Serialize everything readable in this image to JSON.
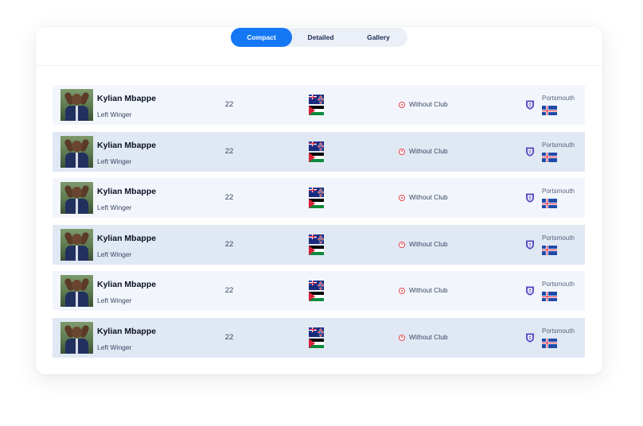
{
  "view_toggle": {
    "tabs": [
      {
        "label": "Compact",
        "active": true
      },
      {
        "label": "Detailed",
        "active": false
      },
      {
        "label": "Gallery",
        "active": false
      }
    ]
  },
  "players": [
    {
      "name": "Kylian Mbappe",
      "position": "Left Winger",
      "age": "22",
      "nationality_flags": [
        "new-zealand-flag",
        "palestine-flag"
      ],
      "club_status": "Without Club",
      "former_club": "Portsmouth",
      "former_club_flag": "iceland-flag"
    },
    {
      "name": "Kylian Mbappe",
      "position": "Left Winger",
      "age": "22",
      "nationality_flags": [
        "new-zealand-flag",
        "palestine-flag"
      ],
      "club_status": "Without Club",
      "former_club": "Portsmouth",
      "former_club_flag": "iceland-flag"
    },
    {
      "name": "Kylian Mbappe",
      "position": "Left Winger",
      "age": "22",
      "nationality_flags": [
        "new-zealand-flag",
        "palestine-flag"
      ],
      "club_status": "Without Club",
      "former_club": "Portsmouth",
      "former_club_flag": "iceland-flag"
    },
    {
      "name": "Kylian Mbappe",
      "position": "Left Winger",
      "age": "22",
      "nationality_flags": [
        "new-zealand-flag",
        "palestine-flag"
      ],
      "club_status": "Without Club",
      "former_club": "Portsmouth",
      "former_club_flag": "iceland-flag"
    },
    {
      "name": "Kylian Mbappe",
      "position": "Left Winger",
      "age": "22",
      "nationality_flags": [
        "new-zealand-flag",
        "palestine-flag"
      ],
      "club_status": "Without Club",
      "former_club": "Portsmouth",
      "former_club_flag": "iceland-flag"
    },
    {
      "name": "Kylian Mbappe",
      "position": "Left Winger",
      "age": "22",
      "nationality_flags": [
        "new-zealand-flag",
        "palestine-flag"
      ],
      "club_status": "Without Club",
      "former_club": "Portsmouth",
      "former_club_flag": "iceland-flag"
    }
  ],
  "colors": {
    "accent": "#1478f5",
    "row_light": "#f2f6fc",
    "row_dark": "#e0e8f3",
    "no_club_icon": "#e3434e",
    "crest": "#5a4fc4"
  }
}
